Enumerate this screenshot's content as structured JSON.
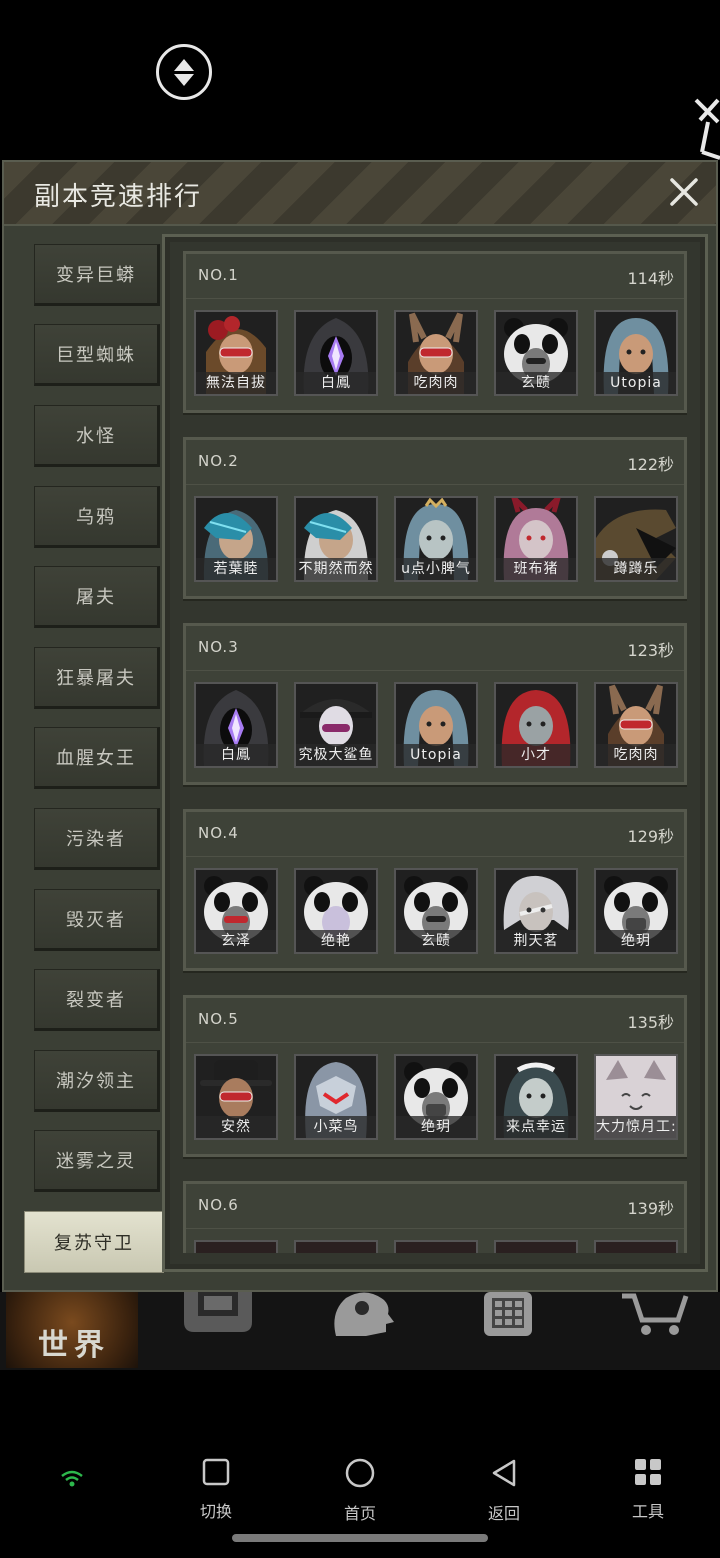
{
  "panel": {
    "title": "副本竞速排行"
  },
  "tabs": [
    {
      "label": "变异巨蟒",
      "active": false
    },
    {
      "label": "巨型蜘蛛",
      "active": false
    },
    {
      "label": "水怪",
      "active": false
    },
    {
      "label": "乌鸦",
      "active": false
    },
    {
      "label": "屠夫",
      "active": false
    },
    {
      "label": "狂暴屠夫",
      "active": false
    },
    {
      "label": "血腥女王",
      "active": false
    },
    {
      "label": "污染者",
      "active": false
    },
    {
      "label": "毁灭者",
      "active": false
    },
    {
      "label": "裂变者",
      "active": false
    },
    {
      "label": "潮汐领主",
      "active": false
    },
    {
      "label": "迷雾之灵",
      "active": false
    },
    {
      "label": "复苏守卫",
      "active": true
    }
  ],
  "rankings": [
    {
      "no": "NO.1",
      "time": "114秒",
      "members": [
        {
          "name": "無法自拔",
          "avatar": "red-hat-girl"
        },
        {
          "name": "白鳳",
          "avatar": "dark-hood-crystal"
        },
        {
          "name": "吃肉肉",
          "avatar": "bunny-ears-goggles"
        },
        {
          "name": "玄赜",
          "avatar": "panda-hood"
        },
        {
          "name": "Utopia",
          "avatar": "blue-hair-girl"
        }
      ]
    },
    {
      "no": "NO.2",
      "time": "122秒",
      "members": [
        {
          "name": "若葉睦",
          "avatar": "feather-mask"
        },
        {
          "name": "不期然而然",
          "avatar": "feather-mask-white"
        },
        {
          "name": "u点小脾气",
          "avatar": "blue-hair-crown"
        },
        {
          "name": "班布猪",
          "avatar": "pink-horns-girl"
        },
        {
          "name": "蹲蹲乐",
          "avatar": "helmet-dark"
        }
      ]
    },
    {
      "no": "NO.3",
      "time": "123秒",
      "members": [
        {
          "name": "白鳳",
          "avatar": "dark-hood-crystal"
        },
        {
          "name": "究极大鲨鱼",
          "avatar": "pirate-hat-pale"
        },
        {
          "name": "Utopia",
          "avatar": "blue-hair-girl"
        },
        {
          "name": "小才",
          "avatar": "red-hood"
        },
        {
          "name": "吃肉肉",
          "avatar": "bunny-ears-goggles"
        }
      ]
    },
    {
      "no": "NO.4",
      "time": "129秒",
      "members": [
        {
          "name": "玄泽",
          "avatar": "panda-hood-goggles"
        },
        {
          "name": "绝艳",
          "avatar": "panda-hood-pale"
        },
        {
          "name": "玄赜",
          "avatar": "panda-hood"
        },
        {
          "name": "荆天茗",
          "avatar": "silver-hair-bandaged"
        },
        {
          "name": "绝玥",
          "avatar": "panda-hood-mask"
        }
      ]
    },
    {
      "no": "NO.5",
      "time": "135秒",
      "members": [
        {
          "name": "安然",
          "avatar": "fedora-goggles"
        },
        {
          "name": "小菜鸟",
          "avatar": "mech-helmet"
        },
        {
          "name": "绝玥",
          "avatar": "panda-hood-mask"
        },
        {
          "name": "来点幸运",
          "avatar": "maid-dark-hair"
        },
        {
          "name": "大力惊月工:",
          "avatar": "white-cat"
        }
      ]
    },
    {
      "no": "NO.6",
      "time": "139秒",
      "members": []
    }
  ],
  "game_nav": {
    "world_label": "世界",
    "icons": [
      "backpack-icon",
      "head-gear-icon",
      "phone-icon",
      "cart-icon"
    ]
  },
  "system_nav": [
    {
      "label": "切换",
      "icon": "square-icon"
    },
    {
      "label": "首页",
      "icon": "circle-icon"
    },
    {
      "label": "返回",
      "icon": "back-triangle-icon"
    },
    {
      "label": "工具",
      "icon": "grid-icon"
    }
  ],
  "colors": {
    "panel_bg": "#3b3f35",
    "card_bg": "#3e4238",
    "active_tab": "#e3e2cf",
    "wifi": "#2db84c"
  }
}
